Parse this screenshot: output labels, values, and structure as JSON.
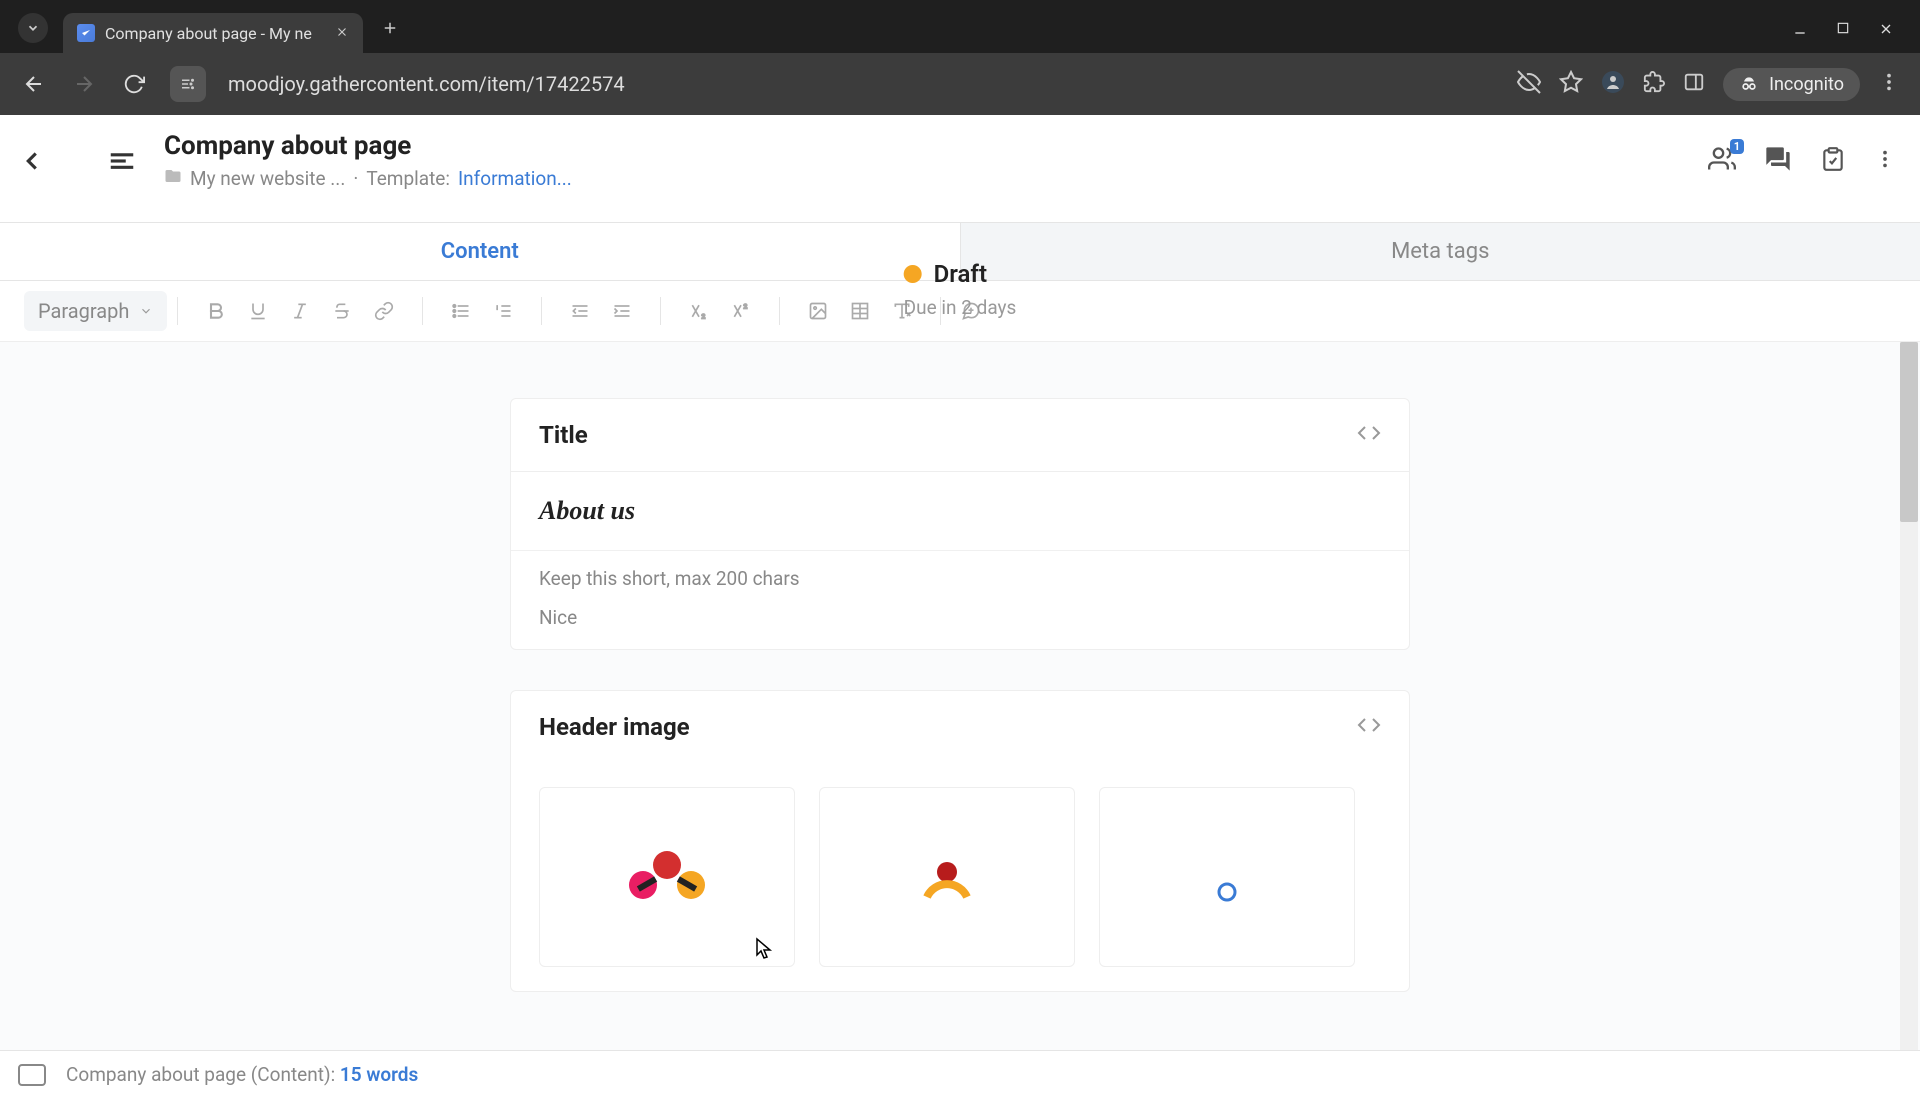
{
  "browser": {
    "tab_title": "Company about page - My ne",
    "url": "moodjoy.gathercontent.com/item/17422574",
    "incognito_label": "Incognito"
  },
  "header": {
    "page_title": "Company about page",
    "breadcrumb_folder": "My new website ...",
    "dot": "·",
    "template_label": "Template:",
    "template_link": "Information...",
    "status_label": "Draft",
    "due_text": "Due in 2 days",
    "people_badge": "1"
  },
  "tabs": {
    "content": "Content",
    "meta": "Meta tags"
  },
  "toolbar": {
    "style_label": "Paragraph"
  },
  "cards": {
    "title": {
      "heading": "Title",
      "value": "About us",
      "hint": "Keep this short, max 200 chars",
      "feedback": "Nice"
    },
    "header_image": {
      "heading": "Header image"
    }
  },
  "footer": {
    "doc_label": "Company about page (Content): ",
    "word_count": "15 words"
  }
}
